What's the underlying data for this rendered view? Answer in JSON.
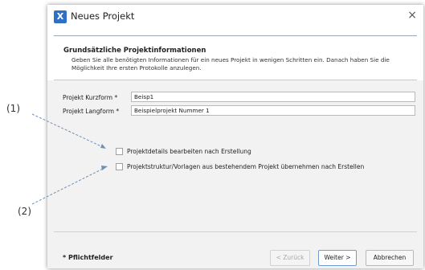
{
  "window": {
    "title": "Neues Projekt",
    "icon_letter": "X",
    "close_glyph": "×"
  },
  "header": {
    "title": "Grundsätzliche Projektinformationen",
    "description": "Geben Sie alle benötigten Informationen für ein neues Projekt in wenigen Schritten ein. Danach haben Sie die Möglichkeit Ihre ersten Protokolle anzulegen."
  },
  "form": {
    "short_label": "Projekt Kurzform *",
    "short_value": "Beisp1",
    "long_label": "Projekt Langform *",
    "long_value": "Beispielprojekt Nummer 1"
  },
  "options": {
    "edit_details_label": "Projektdetails bearbeiten nach Erstellung",
    "adopt_structure_label": "Projektstruktur/Vorlagen aus bestehendem Projekt übernehmen nach Erstellen"
  },
  "footer": {
    "required_note": "* Pflichtfelder",
    "back_label": "< Zurück",
    "next_label": "Weiter >",
    "cancel_label": "Abbrechen"
  },
  "annotations": {
    "one": "(1)",
    "two": "(2)"
  },
  "colors": {
    "accent": "#2f6fc6",
    "arrow": "#6f8fb3"
  }
}
